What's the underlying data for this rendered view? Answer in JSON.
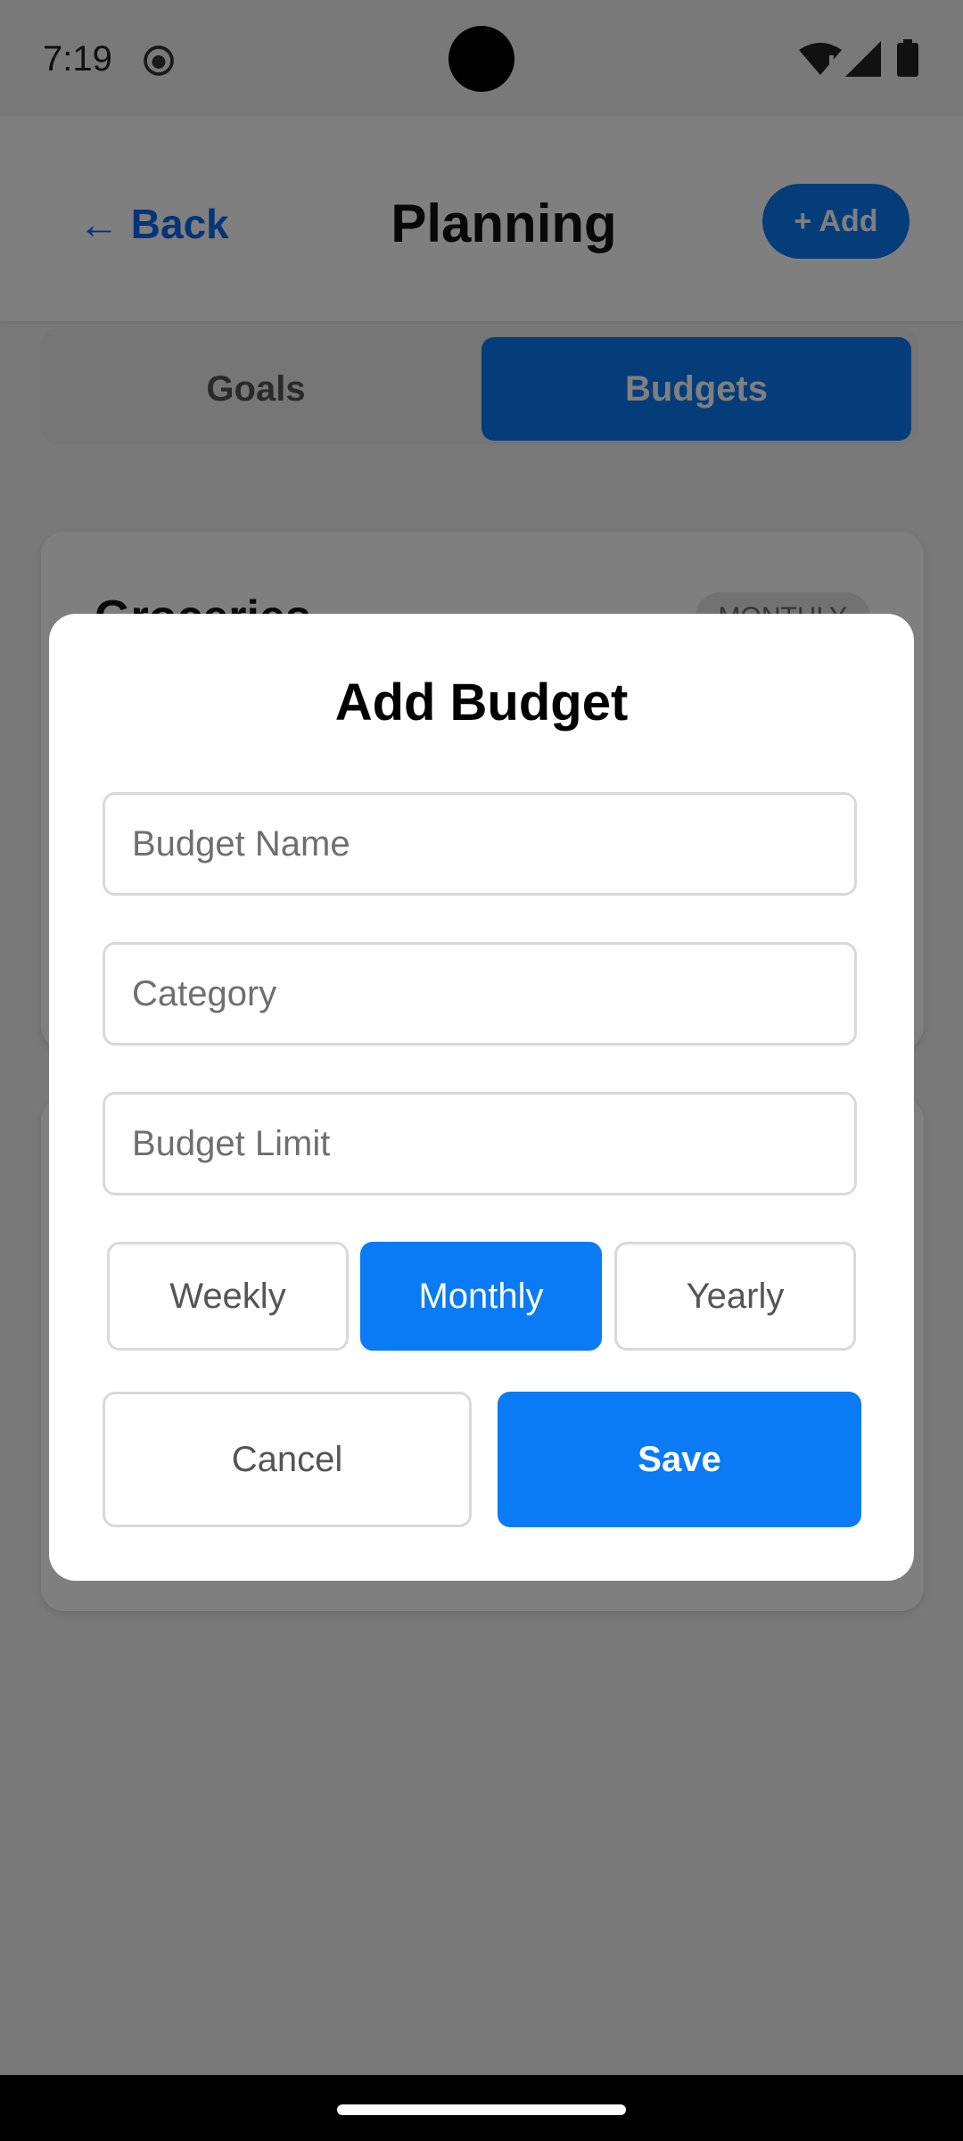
{
  "status_bar": {
    "time": "7:19",
    "icons": [
      "app-notification-icon",
      "wifi-icon",
      "signal-icon",
      "battery-icon"
    ]
  },
  "header": {
    "back_label": "← Back",
    "title": "Planning",
    "add_label": "+ Add"
  },
  "tabs": [
    {
      "label": "Goals",
      "selected": false
    },
    {
      "label": "Budgets",
      "selected": true
    }
  ],
  "background_cards": [
    {
      "title": "Groceries",
      "badge": "MONTHLY"
    }
  ],
  "dialog": {
    "title": "Add Budget",
    "fields": {
      "name": {
        "placeholder": "Budget Name",
        "value": ""
      },
      "category": {
        "placeholder": "Category",
        "value": ""
      },
      "limit": {
        "placeholder": "Budget Limit",
        "value": ""
      }
    },
    "periods": [
      {
        "label": "Weekly",
        "selected": false
      },
      {
        "label": "Monthly",
        "selected": true
      },
      {
        "label": "Yearly",
        "selected": false
      }
    ],
    "cancel_label": "Cancel",
    "save_label": "Save"
  },
  "colors": {
    "accent": "#0a7af5",
    "overlay": "rgba(0,0,0,0.5)",
    "background": "#f2f2f2"
  }
}
